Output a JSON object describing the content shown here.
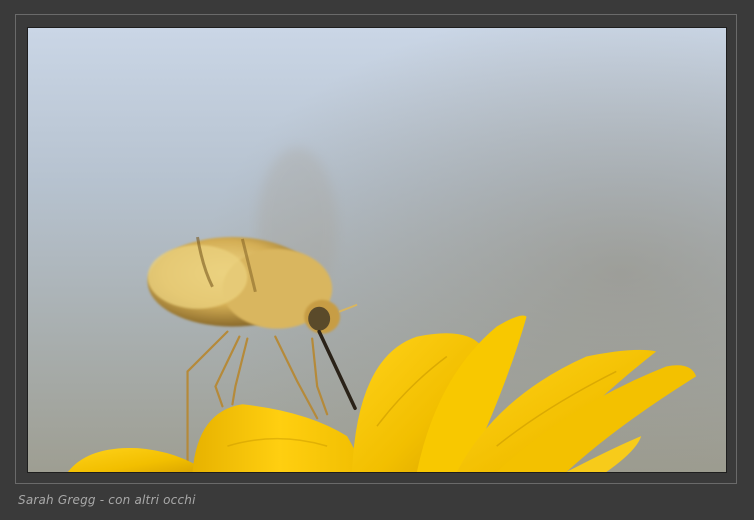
{
  "caption": "Sarah Gregg - con altri occhi",
  "photo": {
    "subject": "bee-fly-on-yellow-flower",
    "colors": {
      "sky_top": "#c9d5e4",
      "sky_bottom": "#a7a79e",
      "petal": "#f2c400",
      "petal_shadow": "#c99a00",
      "fly_fur": "#e4c672",
      "fly_dark": "#7a5a20",
      "frame": "#3a3a3a"
    }
  }
}
